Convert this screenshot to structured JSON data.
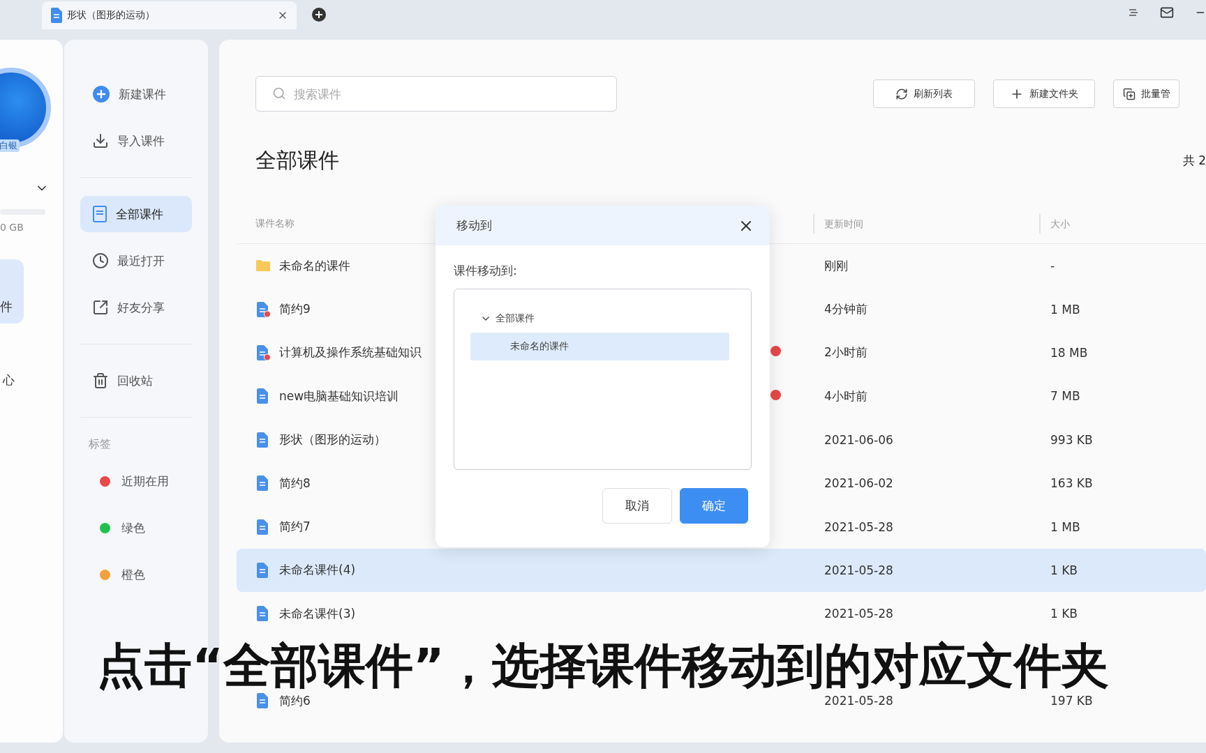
{
  "browser_tab": {
    "title": "形状（图形的运动）"
  },
  "profile": {
    "badge": "白银",
    "storage": "0 GB",
    "nav_item": "件",
    "link": "心"
  },
  "nav": {
    "groups": [
      [
        {
          "label": "新建课件",
          "kind": "new",
          "selected": false
        },
        {
          "label": "导入课件",
          "kind": "import",
          "selected": false
        }
      ],
      [
        {
          "label": "全部课件",
          "kind": "all",
          "selected": true
        },
        {
          "label": "最近打开",
          "kind": "recent",
          "selected": false
        },
        {
          "label": "好友分享",
          "kind": "share",
          "selected": false
        }
      ],
      [
        {
          "label": "回收站",
          "kind": "trash",
          "selected": false
        }
      ]
    ],
    "tags_heading": "标签",
    "tags": [
      {
        "label": "近期在用",
        "color": "#e84848"
      },
      {
        "label": "绿色",
        "color": "#1fc24a"
      },
      {
        "label": "橙色",
        "color": "#f2a23c"
      }
    ]
  },
  "toolbar": {
    "search": {
      "placeholder": "搜索课件"
    },
    "buttons": [
      {
        "label": "刷新列表",
        "kind": "refresh"
      },
      {
        "label": "新建文件夹",
        "kind": "add"
      },
      {
        "label": "批量管",
        "kind": "batch"
      }
    ]
  },
  "title": "全部课件",
  "count": "共 2",
  "table": {
    "columns": [
      "课件名称",
      "更新时间",
      "大小"
    ],
    "rows": [
      {
        "kind": "folder",
        "name": "未命名的课件",
        "updated": "刚刚",
        "size": "-",
        "selected": false,
        "tagged": false
      },
      {
        "kind": "file",
        "name": "简约9",
        "updated": "4分钟前",
        "size": "1 MB",
        "selected": false,
        "badge": true,
        "tagged": false
      },
      {
        "kind": "file",
        "name": "计算机及操作系统基础知识",
        "updated": "2小时前",
        "size": "18 MB",
        "selected": false,
        "badge": true,
        "tagged": true
      },
      {
        "kind": "file",
        "name": "new电脑基础知识培训",
        "updated": "4小时前",
        "size": "7 MB",
        "selected": false,
        "badge": false,
        "tagged": true
      },
      {
        "kind": "file",
        "name": "形状（图形的运动）",
        "updated": "2021-06-06",
        "size": "993 KB",
        "selected": false,
        "badge": false,
        "tagged": false
      },
      {
        "kind": "file",
        "name": "简约8",
        "updated": "2021-06-02",
        "size": "163 KB",
        "selected": false,
        "badge": false,
        "tagged": false
      },
      {
        "kind": "file",
        "name": "简约7",
        "updated": "2021-05-28",
        "size": "1 MB",
        "selected": false,
        "badge": false,
        "tagged": false
      },
      {
        "kind": "file",
        "name": "未命名课件(4)",
        "updated": "2021-05-28",
        "size": "1 KB",
        "selected": true,
        "badge": false,
        "tagged": false
      },
      {
        "kind": "file",
        "name": "未命名课件(3)",
        "updated": "2021-05-28",
        "size": "1 KB",
        "selected": false,
        "badge": false,
        "tagged": false
      },
      {
        "kind": "covered"
      },
      {
        "kind": "file",
        "name": "简约6",
        "updated": "2021-05-28",
        "size": "197 KB",
        "selected": false,
        "badge": false,
        "tagged": false
      }
    ]
  },
  "dialog": {
    "title": "移动到",
    "label": "课件移动到:",
    "tree": [
      {
        "label": "全部课件",
        "expanded": true,
        "selected": false,
        "children": [
          {
            "label": "未命名的课件",
            "selected": true
          }
        ]
      }
    ],
    "buttons": [
      {
        "label": "取消",
        "kind": "secondary"
      },
      {
        "label": "确定",
        "kind": "primary"
      }
    ]
  },
  "caption": "点击“全部课件”，选择课件移动到的对应文件夹"
}
